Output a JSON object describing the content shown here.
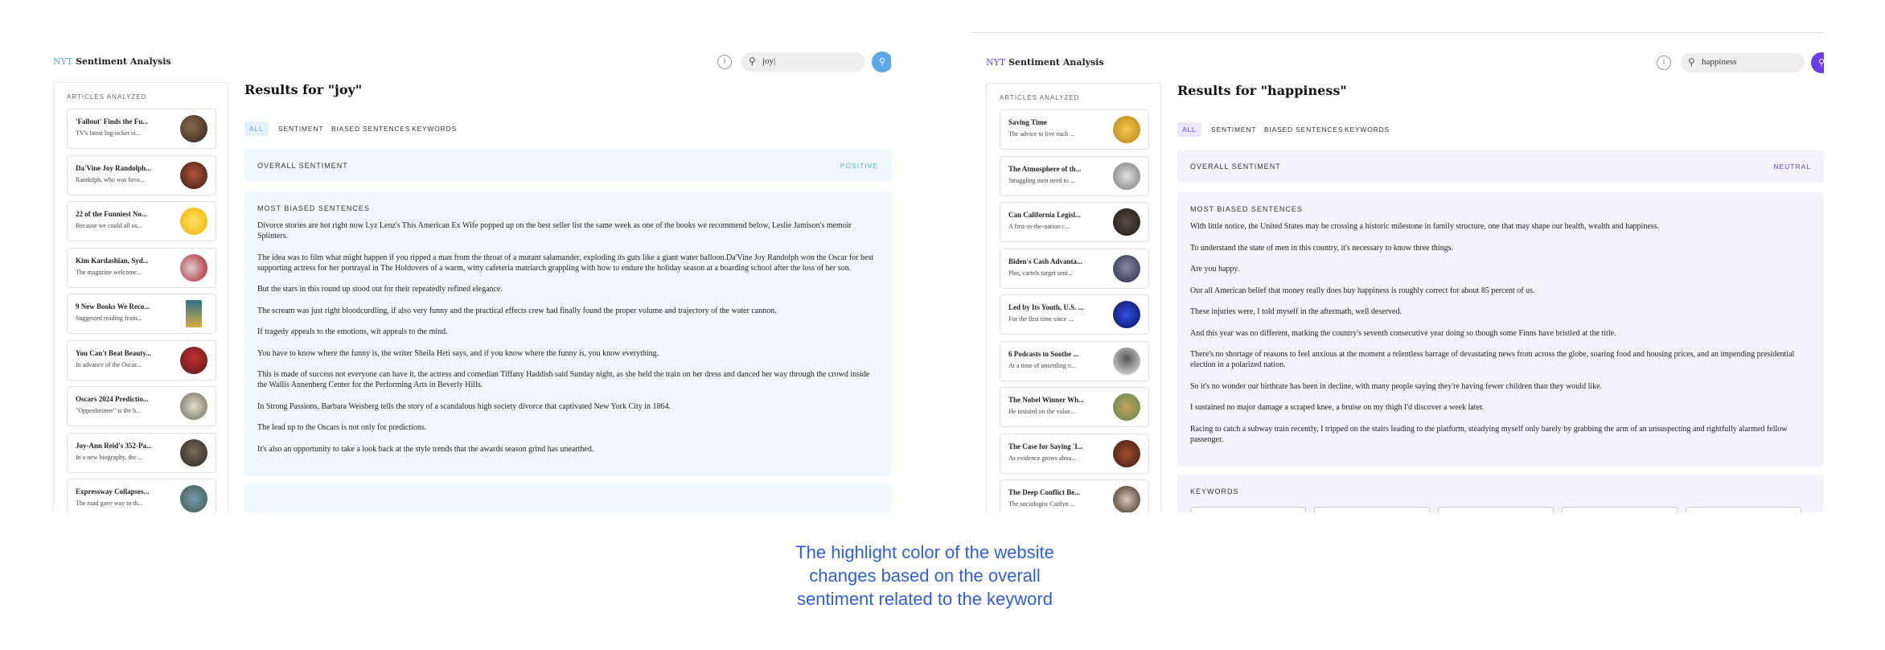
{
  "colors": {
    "joy_accent": "#5aa9e6",
    "joy_bg": "#f0f7fd",
    "happiness_accent": "#6a3de8",
    "happiness_bg": "#f4f2fd",
    "caption": "#2f5fe0"
  },
  "panels": [
    {
      "brand": {
        "nyt": "NYT",
        "name": "Sentiment Analysis"
      },
      "info_icon": "i",
      "search": {
        "icon": "search-icon",
        "value": "joy|"
      },
      "search_button_icon": "search-icon",
      "sidebar": {
        "title": "ARTICLES ANALYZED",
        "articles": [
          {
            "title": "'Fallout' Finds the Fu...",
            "snippet": "TV's latest big-ticket vi..."
          },
          {
            "title": "Da'Vine Joy Randolph...",
            "snippet": "Randolph, who was favo..."
          },
          {
            "title": "22 of the Funniest No...",
            "snippet": "Because we could all us..."
          },
          {
            "title": "Kim Kardashian, Syd...",
            "snippet": "The magazine welcome..."
          },
          {
            "title": "9 New Books We Reco...",
            "snippet": "Suggested reading from..."
          },
          {
            "title": "You Can't Beat Beauty...",
            "snippet": "In advance of the Oscar..."
          },
          {
            "title": "Oscars 2024 Predictio...",
            "snippet": "\"Oppenheimer\" is the b..."
          },
          {
            "title": "Joy-Ann Reid's 352-Pa...",
            "snippet": "In a new biography, the ..."
          },
          {
            "title": "Expressway Collapses...",
            "snippet": "The road gave way in th..."
          }
        ]
      },
      "results_title": "Results for \"joy\"",
      "tabs": [
        "ALL",
        "SENTIMENT",
        "BIASED SENTENCES",
        "KEYWORDS"
      ],
      "overall": {
        "label": "OVERALL SENTIMENT",
        "value": "POSITIVE"
      },
      "biased": {
        "label": "MOST BIASED SENTENCES",
        "sentences": [
          "Divorce stories are hot right now Lyz Lenz's This American Ex Wife popped up on the best seller list the same week as one of the books we recommend below, Leslie Jamison's memoir Splinters.",
          "The idea was to film what might happen if you ripped a man from the throat of a mutant salamander, exploding its guts like a giant water balloon.Da'Vine Joy Randolph won the Oscar for best supporting actress for her portrayal in The Holdovers of a warm, witty cafeteria matriarch grappling with how to endure the holiday season at a boarding school after the loss of her son.",
          "But the stars in this round up stood out for their repeatedly refined elegance.",
          "The scream was just right bloodcurdling, if also very funny and the practical effects crew had finally found the proper volume and trajectory of the water cannon.",
          "If tragedy appeals to the emotions, wit appeals to the mind.",
          "You have to know where the funny is, the writer Sheila Heti says, and if you know where the funny is, you know everything.",
          "This is made of success not everyone can have it, the actress and comedian Tiffany Haddish said Sunday night, as she held the train on her dress and danced her way through the crowd inside the Wallis Annenberg Center for the Performing Arts in Beverly Hills.",
          "In Strong Passions, Barbara Weisberg tells the story of a scandalous high society divorce that captivated New York City in 1864.",
          "The lead up to the Oscars is not only for predictions.",
          "It's also an opportunity to take a look back at the style trends that the awards season grind has unearthed."
        ]
      }
    },
    {
      "brand": {
        "nyt": "NYT",
        "name": "Sentiment Analysis"
      },
      "info_icon": "i",
      "search": {
        "icon": "search-icon",
        "value": "happiness"
      },
      "search_button_icon": "search-icon",
      "sidebar": {
        "title": "ARTICLES ANALYZED",
        "articles": [
          {
            "title": "Saving Time",
            "snippet": "The advice to live each ..."
          },
          {
            "title": "The Atmosphere of th...",
            "snippet": "Struggling men need to ..."
          },
          {
            "title": "Can California Legisl...",
            "snippet": "A first-in-the-nation c..."
          },
          {
            "title": "Biden's Cash Advanta...",
            "snippet": "Plus, cartels target seni..."
          },
          {
            "title": "Led by Its Youth, U.S. ...",
            "snippet": "For the first time since ..."
          },
          {
            "title": "6 Podcasts to Soothe ...",
            "snippet": "At a time of unsettling n..."
          },
          {
            "title": "The Nobel Winner Wh...",
            "snippet": "He insisted on the value..."
          },
          {
            "title": "The Case for Saying 'I...",
            "snippet": "As evidence grows abou..."
          },
          {
            "title": "The Deep Conflict Be...",
            "snippet": "The sociologist Caitlyn ..."
          }
        ]
      },
      "results_title": "Results for \"happiness\"",
      "tabs": [
        "ALL",
        "SENTIMENT",
        "BIASED SENTENCES",
        "KEYWORDS"
      ],
      "overall": {
        "label": "OVERALL SENTIMENT",
        "value": "NEUTRAL"
      },
      "biased": {
        "label": "MOST BIASED SENTENCES",
        "sentences": [
          "With little notice, the United States may be crossing a historic milestone in family structure, one that may shape our health, wealth and happiness.",
          "To understand the state of men in this country, it's necessary to know three things.",
          "Are you happy.",
          "Our all American belief that money really does buy happiness is roughly correct for about 85 percent of us.",
          "These injuries were, I told myself in the aftermath, well deserved.",
          "And this year was no different, marking the country's seventh consecutive year doing so though some Finns have bristled at the title.",
          "There's no shortage of reasons to feel anxious at the moment a relentless barrage of devastating news from across the globe, soaring food and housing prices, and an impending presidential election in a polarized nation.",
          "So it's no wonder our birthrate has been in decline, with many people saying they're having fewer children than they would like.",
          "I sustained no major damage a scraped knee, a bruise on my thigh I'd discover a week later.",
          "Racing to catch a subway train recently, I tripped on the stairs leading to the platform, steadying myself only barely by grabbing the arm of an unsuspecting and rightfully alarmed fellow passenger."
        ]
      },
      "keywords": {
        "label": "KEYWORDS"
      }
    }
  ],
  "caption": {
    "line1": "The highlight color of the website",
    "line2": "changes based on the overall",
    "line3": "sentiment related to the keyword"
  }
}
